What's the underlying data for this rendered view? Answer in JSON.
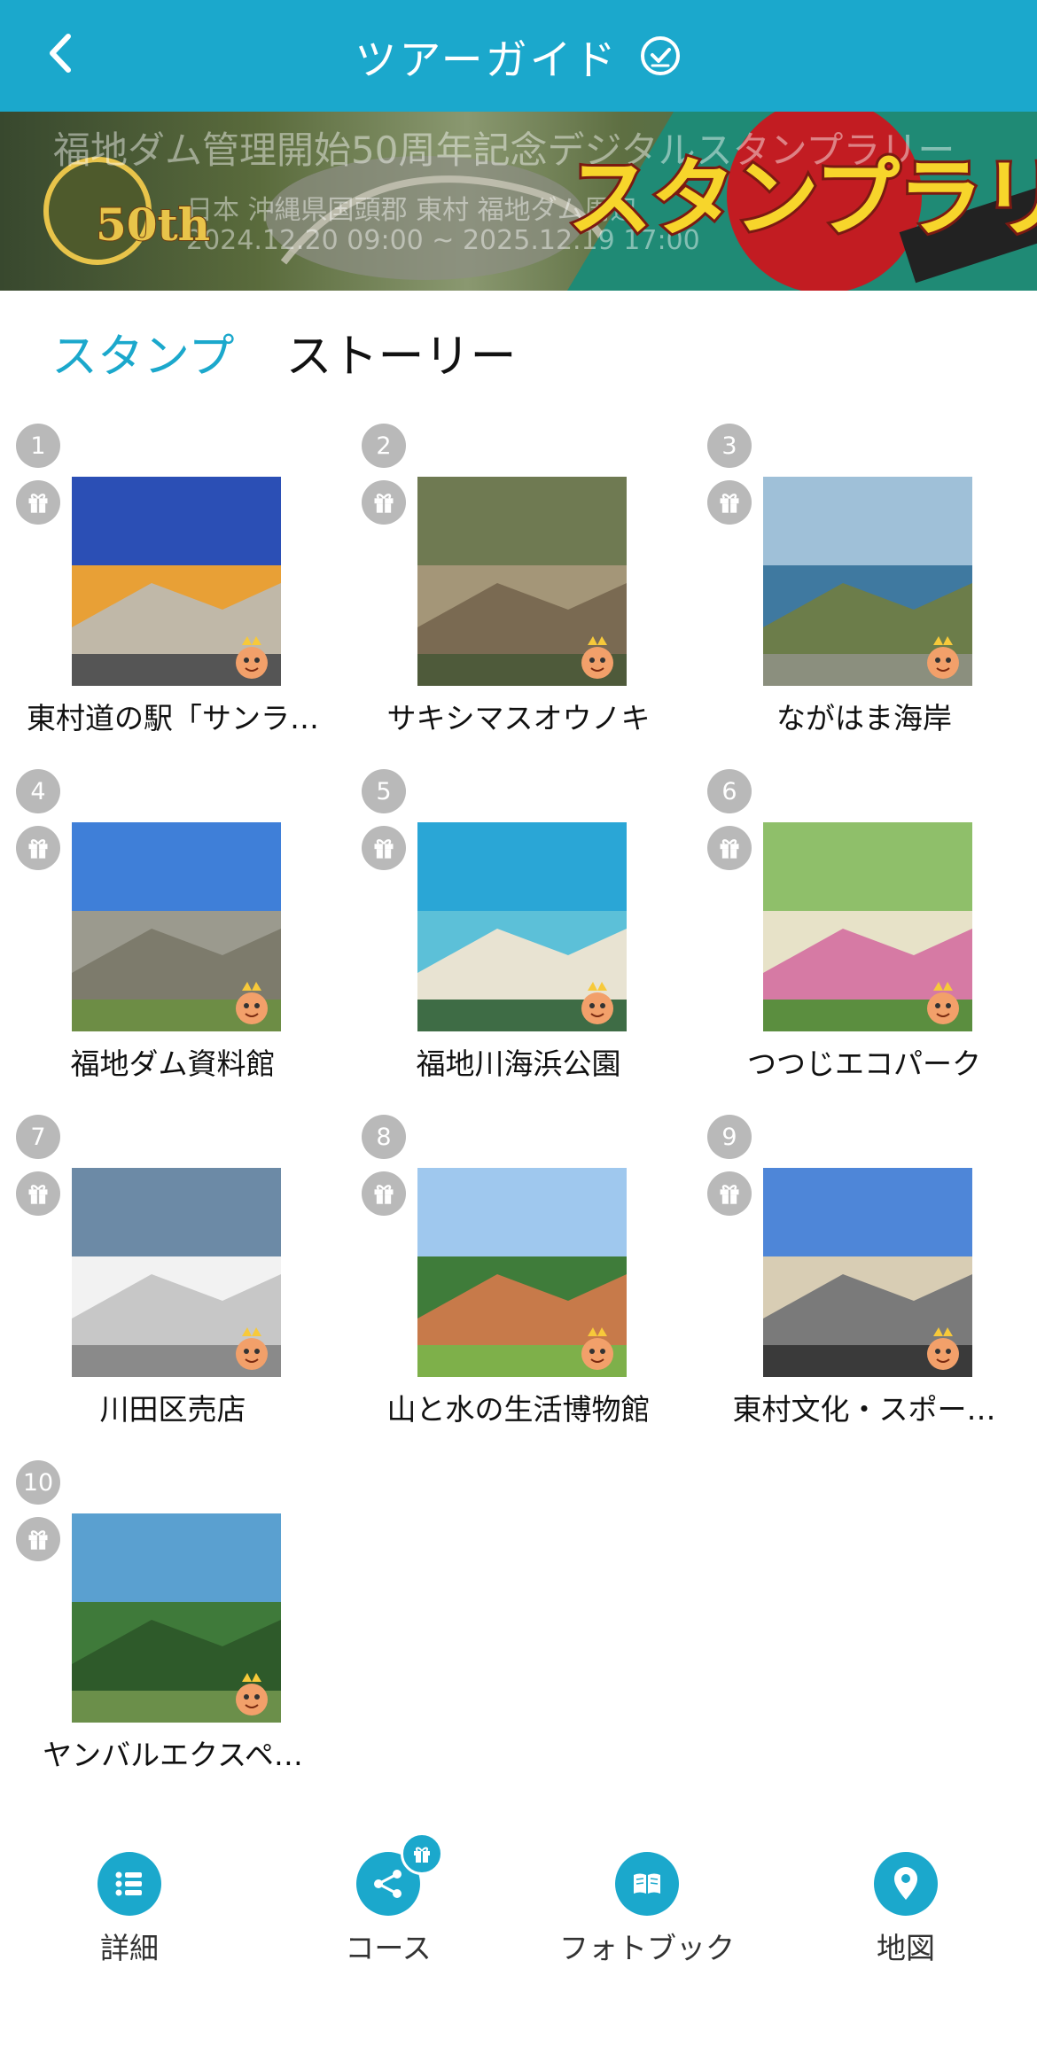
{
  "header": {
    "title": "ツアーガイド"
  },
  "banner": {
    "title": "福地ダム管理開始50周年記念デジタルスタンプラリー",
    "location": "日本 沖縄県国頭郡 東村 福地ダム周辺",
    "period": "2024.12.20 09:00 ~ 2025.12.19 17:00",
    "rally_text": "スタンプラリー",
    "logo_text": "50th"
  },
  "tabs": {
    "stamp": "スタンプ",
    "story": "ストーリー"
  },
  "spots": [
    {
      "num": "1",
      "name": "東村道の駅「サンラ…",
      "colors": [
        "#2b4fb5",
        "#e8a036",
        "#c0b8a8",
        "#555"
      ]
    },
    {
      "num": "2",
      "name": "サキシマスオウノキ",
      "colors": [
        "#6f7a52",
        "#a49678",
        "#7a6a52",
        "#4e5a3a"
      ]
    },
    {
      "num": "3",
      "name": "ながはま海岸",
      "colors": [
        "#9fc0d8",
        "#3f79a0",
        "#6c7d4a",
        "#8b8f7e"
      ]
    },
    {
      "num": "4",
      "name": "福地ダム資料館",
      "colors": [
        "#3f7fd8",
        "#9b9a8e",
        "#7d7b6c",
        "#6d8d45"
      ]
    },
    {
      "num": "5",
      "name": "福地川海浜公園",
      "colors": [
        "#2aa6d6",
        "#5cc0d8",
        "#e8e3d2",
        "#3e6c45"
      ]
    },
    {
      "num": "6",
      "name": "つつじエコパーク",
      "colors": [
        "#8fbf6a",
        "#e7e2c8",
        "#d67aa4",
        "#5b8e3f"
      ]
    },
    {
      "num": "7",
      "name": "川田区売店",
      "colors": [
        "#6c8aa6",
        "#f2f2f2",
        "#c7c7c7",
        "#8a8a8a"
      ]
    },
    {
      "num": "8",
      "name": "山と水の生活博物館",
      "colors": [
        "#9fc8ee",
        "#3f7c3a",
        "#c77a4a",
        "#7eb04a"
      ]
    },
    {
      "num": "9",
      "name": "東村文化・スポー…",
      "colors": [
        "#4e86d8",
        "#d8cdb4",
        "#7a7a7a",
        "#3a3a3a"
      ]
    },
    {
      "num": "10",
      "name": "ヤンバルエクスペ…",
      "colors": [
        "#5aa0d0",
        "#3f7a3a",
        "#2e5a2a",
        "#6b8f4a"
      ]
    }
  ],
  "bottom_nav": {
    "details": "詳細",
    "course": "コース",
    "photobook": "フォトブック",
    "map": "地図"
  },
  "icons": {
    "back": "chevron-left-icon",
    "check": "check-circle-icon",
    "gift": "gift-icon",
    "list": "list-icon",
    "share": "share-icon",
    "book": "book-icon",
    "pin": "map-pin-icon"
  },
  "colors": {
    "accent": "#1ba8cc",
    "badge_gray": "#b9b9b9",
    "text": "#111111"
  }
}
